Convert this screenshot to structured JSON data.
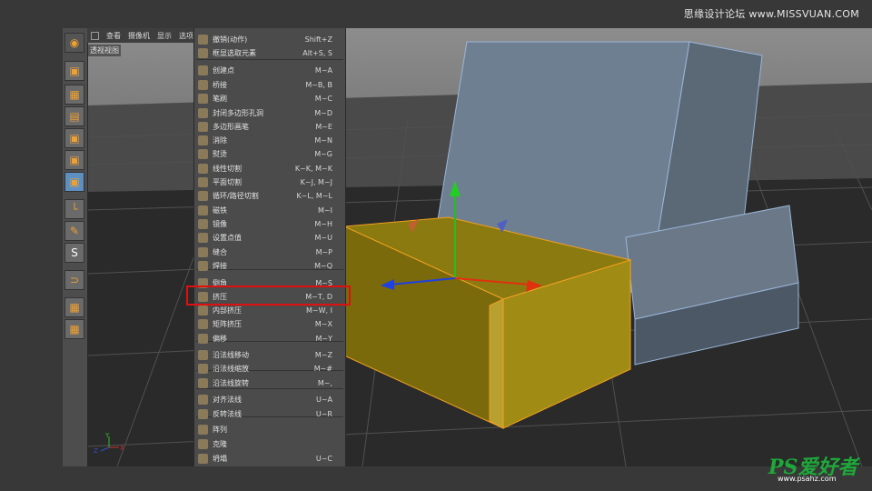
{
  "watermark_top": "思缘设计论坛 www.MISSVUAN.COM",
  "watermark_bottom": "PS爱好者",
  "watermark_bottom_url": "www.psahz.com",
  "viewport": {
    "header_items": [
      "查看",
      "摄像机",
      "显示",
      "选项"
    ],
    "label": "透视视图"
  },
  "menu": {
    "items": [
      {
        "label": "撤销(动作)",
        "shortcut": "Shift+Z",
        "icon": "undo-icon"
      },
      {
        "label": "框显选取元素",
        "shortcut": "Alt+S, S",
        "icon": "frame-selection-icon"
      },
      {
        "label": "创建点",
        "shortcut": "M~A",
        "icon": "create-point-icon"
      },
      {
        "label": "桥接",
        "shortcut": "M~B, B",
        "icon": "bridge-icon"
      },
      {
        "label": "笔刷",
        "shortcut": "M~C",
        "icon": "brush-icon"
      },
      {
        "label": "封闭多边形孔洞",
        "shortcut": "M~D",
        "icon": "close-hole-icon"
      },
      {
        "label": "多边形画笔",
        "shortcut": "M~E",
        "icon": "polygon-pen-icon"
      },
      {
        "label": "消除",
        "shortcut": "M~N",
        "icon": "dissolve-icon"
      },
      {
        "label": "熨烫",
        "shortcut": "M~G",
        "icon": "iron-icon"
      },
      {
        "label": "线性切割",
        "shortcut": "K~K, M~K",
        "icon": "line-cut-icon"
      },
      {
        "label": "平面切割",
        "shortcut": "K~J, M~J",
        "icon": "plane-cut-icon"
      },
      {
        "label": "循环/路径切割",
        "shortcut": "K~L, M~L",
        "icon": "loop-cut-icon"
      },
      {
        "label": "磁铁",
        "shortcut": "M~I",
        "icon": "magnet-icon"
      },
      {
        "label": "镜像",
        "shortcut": "M~H",
        "icon": "mirror-icon"
      },
      {
        "label": "设置点值",
        "shortcut": "M~U",
        "icon": "set-point-value-icon"
      },
      {
        "label": "缝合",
        "shortcut": "M~P",
        "icon": "stitch-icon"
      },
      {
        "label": "焊接",
        "shortcut": "M~Q",
        "icon": "weld-icon"
      },
      {
        "label": "倒角",
        "shortcut": "M~S",
        "icon": "bevel-icon"
      },
      {
        "label": "挤压",
        "shortcut": "M~T, D",
        "icon": "extrude-icon"
      },
      {
        "label": "内部挤压",
        "shortcut": "M~W, I",
        "icon": "extrude-inner-icon"
      },
      {
        "label": "矩阵挤压",
        "shortcut": "M~X",
        "icon": "matrix-extrude-icon"
      },
      {
        "label": "偏移",
        "shortcut": "M~Y",
        "icon": "offset-icon"
      },
      {
        "label": "沿法线移动",
        "shortcut": "M~Z",
        "icon": "normal-move-icon"
      },
      {
        "label": "沿法线缩放",
        "shortcut": "M~#",
        "icon": "normal-scale-icon"
      },
      {
        "label": "沿法线旋转",
        "shortcut": "M~,",
        "icon": "normal-rotate-icon"
      },
      {
        "label": "对齐法线",
        "shortcut": "U~A",
        "icon": "align-normals-icon"
      },
      {
        "label": "反转法线",
        "shortcut": "U~R",
        "icon": "reverse-normals-icon"
      },
      {
        "label": "阵列",
        "shortcut": "",
        "icon": "array-icon"
      },
      {
        "label": "克隆",
        "shortcut": "",
        "icon": "clone-icon"
      },
      {
        "label": "坍塌",
        "shortcut": "U~C",
        "icon": "collapse-icon"
      }
    ],
    "highlighted": "挤压"
  },
  "axis_labels": {
    "y": "Y",
    "z": "Z",
    "x": "X"
  },
  "colors": {
    "selection_orange": "#f0a020",
    "highlight_red": "#e01010",
    "object_blue": "#6f7f92",
    "menu_bg": "#4b4b4b"
  }
}
